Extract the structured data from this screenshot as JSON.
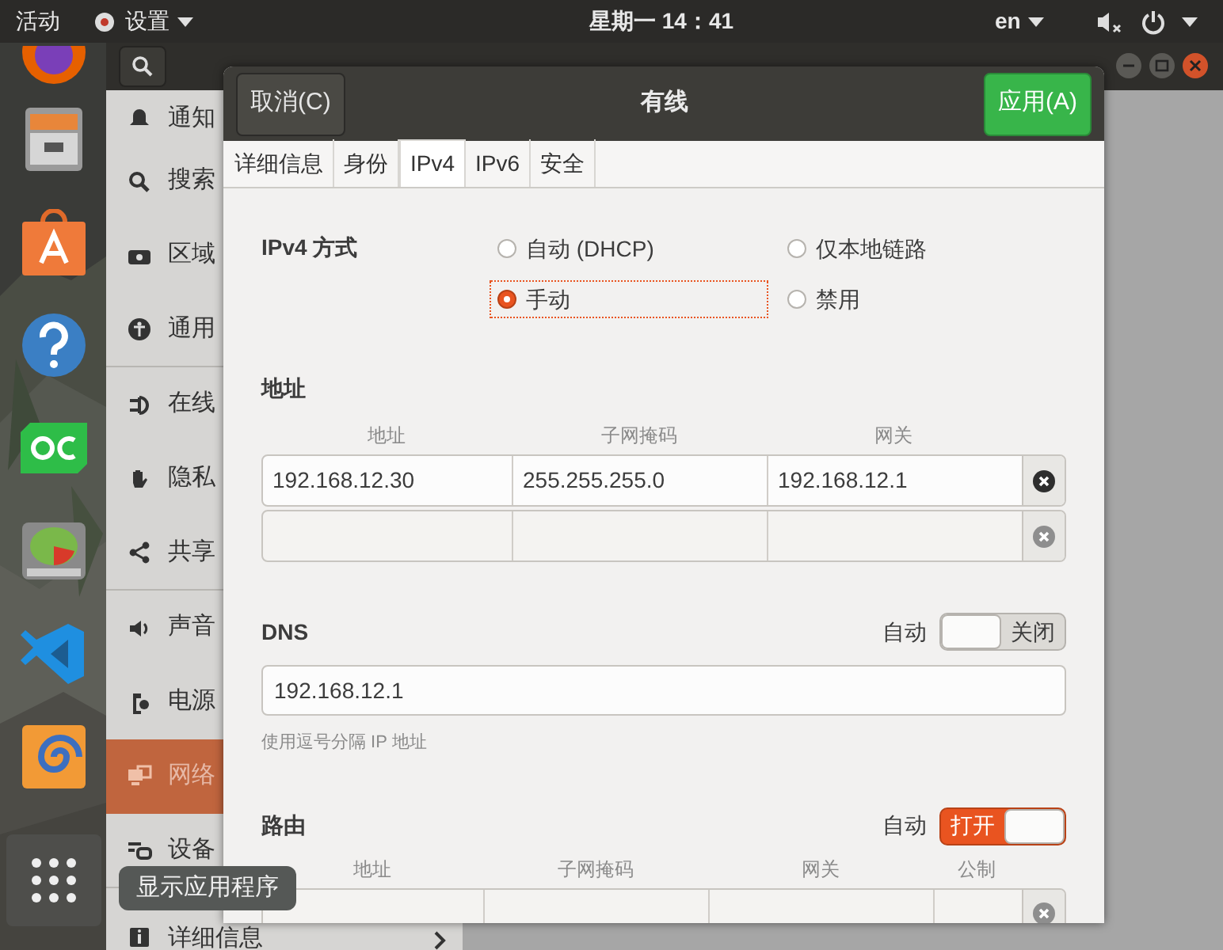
{
  "top_bar": {
    "activities": "活动",
    "app_menu": "设置",
    "clock": "星期一 14：41",
    "language": "en"
  },
  "dock": {
    "tooltip": "显示应用程序"
  },
  "settings": {
    "sidebar": [
      {
        "label": "通知",
        "selected": false
      },
      {
        "label": "搜索",
        "selected": false
      },
      {
        "label": "区域",
        "selected": false
      },
      {
        "label": "通用",
        "selected": false
      },
      {
        "label": "在线",
        "selected": false
      },
      {
        "label": "隐私",
        "selected": false
      },
      {
        "label": "共享",
        "selected": false
      },
      {
        "label": "声音",
        "selected": false
      },
      {
        "label": "电源",
        "selected": false
      },
      {
        "label": "网络",
        "selected": true
      },
      {
        "label": "设备",
        "selected": false
      },
      {
        "label": "详细信息",
        "selected": false
      }
    ]
  },
  "dialog": {
    "cancel": "取消(C)",
    "title": "有线",
    "apply": "应用(A)",
    "tabs": [
      {
        "label": "详细信息",
        "selected": false
      },
      {
        "label": "身份",
        "selected": false
      },
      {
        "label": "IPv4",
        "selected": true
      },
      {
        "label": "IPv6",
        "selected": false
      },
      {
        "label": "安全",
        "selected": false
      }
    ],
    "ipv4_method": {
      "label": "IPv4 方式",
      "options": [
        {
          "label": "自动 (DHCP)",
          "selected": false
        },
        {
          "label": "仅本地链路",
          "selected": false
        },
        {
          "label": "手动",
          "selected": true
        },
        {
          "label": "禁用",
          "selected": false
        }
      ]
    },
    "addresses": {
      "title": "地址",
      "columns": [
        "地址",
        "子网掩码",
        "网关"
      ],
      "rows": [
        {
          "kind": "filled",
          "address": "192.168.12.30",
          "netmask": "255.255.255.0",
          "gateway": "192.168.12.1"
        },
        {
          "kind": "blank"
        }
      ]
    },
    "dns": {
      "title": "DNS",
      "auto_label": "自动",
      "toggle": {
        "on": false,
        "label": "关闭"
      },
      "value": "192.168.12.1",
      "hint": "使用逗号分隔 IP 地址"
    },
    "routes": {
      "title": "路由",
      "auto_label": "自动",
      "toggle": {
        "on": true,
        "label": "打开"
      },
      "columns": [
        "地址",
        "子网掩码",
        "网关",
        "公制"
      ],
      "rows": [
        {
          "kind": "blank"
        }
      ]
    }
  }
}
